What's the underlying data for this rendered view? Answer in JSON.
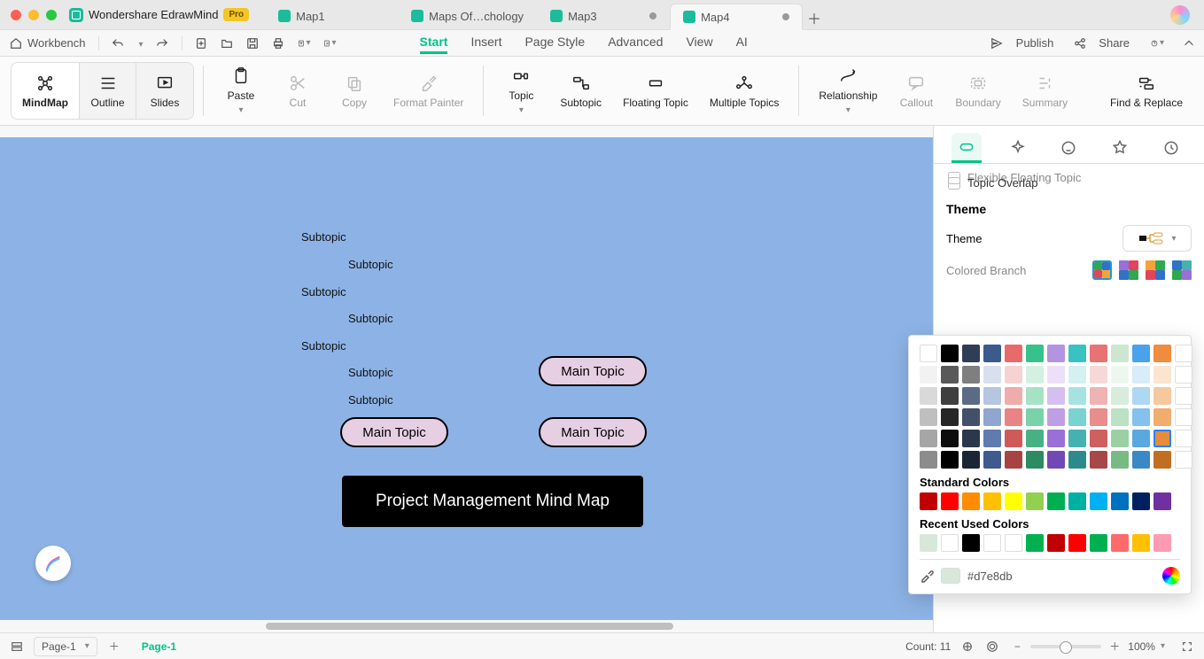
{
  "app": {
    "name": "Wondershare EdrawMind",
    "badge": "Pro"
  },
  "traffic": {
    "red": "#ff5f57",
    "amber": "#febc2e",
    "green": "#28c840"
  },
  "doc_tabs": [
    {
      "label": "Map1",
      "active": false,
      "dirty": false
    },
    {
      "label": "Maps Of…chology",
      "active": false,
      "dirty": false
    },
    {
      "label": "Map3",
      "active": false,
      "dirty": true
    },
    {
      "label": "Map4",
      "active": true,
      "dirty": true
    }
  ],
  "quickbar": {
    "workbench": "Workbench",
    "right": {
      "publish": "Publish",
      "share": "Share"
    }
  },
  "menus": [
    "Start",
    "Insert",
    "Page Style",
    "Advanced",
    "View",
    "AI"
  ],
  "active_menu": "Start",
  "toolbar": {
    "viewmodes": [
      "MindMap",
      "Outline",
      "Slides"
    ],
    "active_viewmode": "MindMap",
    "paste": "Paste",
    "cut": "Cut",
    "copy": "Copy",
    "format_painter": "Format Painter",
    "topic": "Topic",
    "subtopic": "Subtopic",
    "floating": "Floating Topic",
    "multiple": "Multiple Topics",
    "relationship": "Relationship",
    "callout": "Callout",
    "boundary": "Boundary",
    "summary": "Summary",
    "find_replace": "Find & Replace"
  },
  "mindmap": {
    "root": "Project Management Mind Map",
    "main_topics": [
      "Main Topic",
      "Main Topic",
      "Main Topic"
    ],
    "subtopics": [
      "Subtopic",
      "Subtopic",
      "Subtopic",
      "Subtopic",
      "Subtopic",
      "Subtopic",
      "Subtopic"
    ]
  },
  "panel": {
    "chk_truncated": "Flexible Floating Topic",
    "chk_overlap": "Topic Overlap",
    "theme_header": "Theme",
    "theme_label": "Theme",
    "colored_branch_label": "Colored Branch"
  },
  "color_picker": {
    "main_grid": [
      [
        "#ffffff",
        "#000000",
        "#2f3e56",
        "#3b5b8c",
        "#e86a6a",
        "#37c28c",
        "#b493e0",
        "#39c2c2",
        "#e77373",
        "#cde6d0",
        "#4aa3ea",
        "#f08c3d",
        "#ffffff"
      ],
      [
        "#f2f2f2",
        "#595959",
        "#7f7f7f",
        "#d8e0ee",
        "#f7d2d2",
        "#d4f0e2",
        "#ecdff7",
        "#d4f0f0",
        "#f7d8d8",
        "#eef7ef",
        "#d8ecfa",
        "#fbe4d0",
        "#ffffff"
      ],
      [
        "#d9d9d9",
        "#3f3f3f",
        "#5b6b85",
        "#b6c5e0",
        "#f0abab",
        "#a7e2c6",
        "#d5bff0",
        "#a7e2e2",
        "#f0b3b3",
        "#d7ecda",
        "#aed7f3",
        "#f6c89f",
        "#ffffff"
      ],
      [
        "#bfbfbf",
        "#262626",
        "#42506a",
        "#8fa6cf",
        "#e98484",
        "#79d3aa",
        "#be9fe6",
        "#79d3d3",
        "#e98c8c",
        "#bde1c3",
        "#84c1ec",
        "#f1ac6e",
        "#ffffff"
      ],
      [
        "#a6a6a6",
        "#0d0d0d",
        "#2b374b",
        "#5f7bb0",
        "#cf5a5a",
        "#47b185",
        "#9a6fd6",
        "#47b1b1",
        "#cf6060",
        "#9bd0a4",
        "#5aa8e0",
        "#e58d3a",
        "#ffffff"
      ],
      [
        "#8c8c8c",
        "#000000",
        "#1b2635",
        "#3e5a8f",
        "#a84343",
        "#2d8a63",
        "#7248b5",
        "#2d8a8a",
        "#a84747",
        "#78ba84",
        "#3b88c7",
        "#c06f22",
        "#ffffff"
      ]
    ],
    "standard_header": "Standard Colors",
    "standard": [
      "#c00000",
      "#ff0000",
      "#ff8b00",
      "#ffc000",
      "#ffff00",
      "#92d050",
      "#00b050",
      "#00b0a0",
      "#00b0f0",
      "#0070c0",
      "#002060",
      "#7030a0"
    ],
    "recent_header": "Recent Used Colors",
    "recent": [
      "#d7e8db",
      "#ffffff",
      "#000000",
      "#ffffff",
      "#ffffff",
      "#00b050",
      "#c00000",
      "#ff0000",
      "#00b050",
      "#ff6b6b",
      "#ffc000",
      "#ff9bb3"
    ],
    "current_hex": "#d7e8db",
    "current_sw": "#d7e8db",
    "selected_cell": "4-11"
  },
  "statusbar": {
    "page": "Page-1",
    "active_page": "Page-1",
    "count_label": "Count: 11",
    "zoom": "100%"
  }
}
